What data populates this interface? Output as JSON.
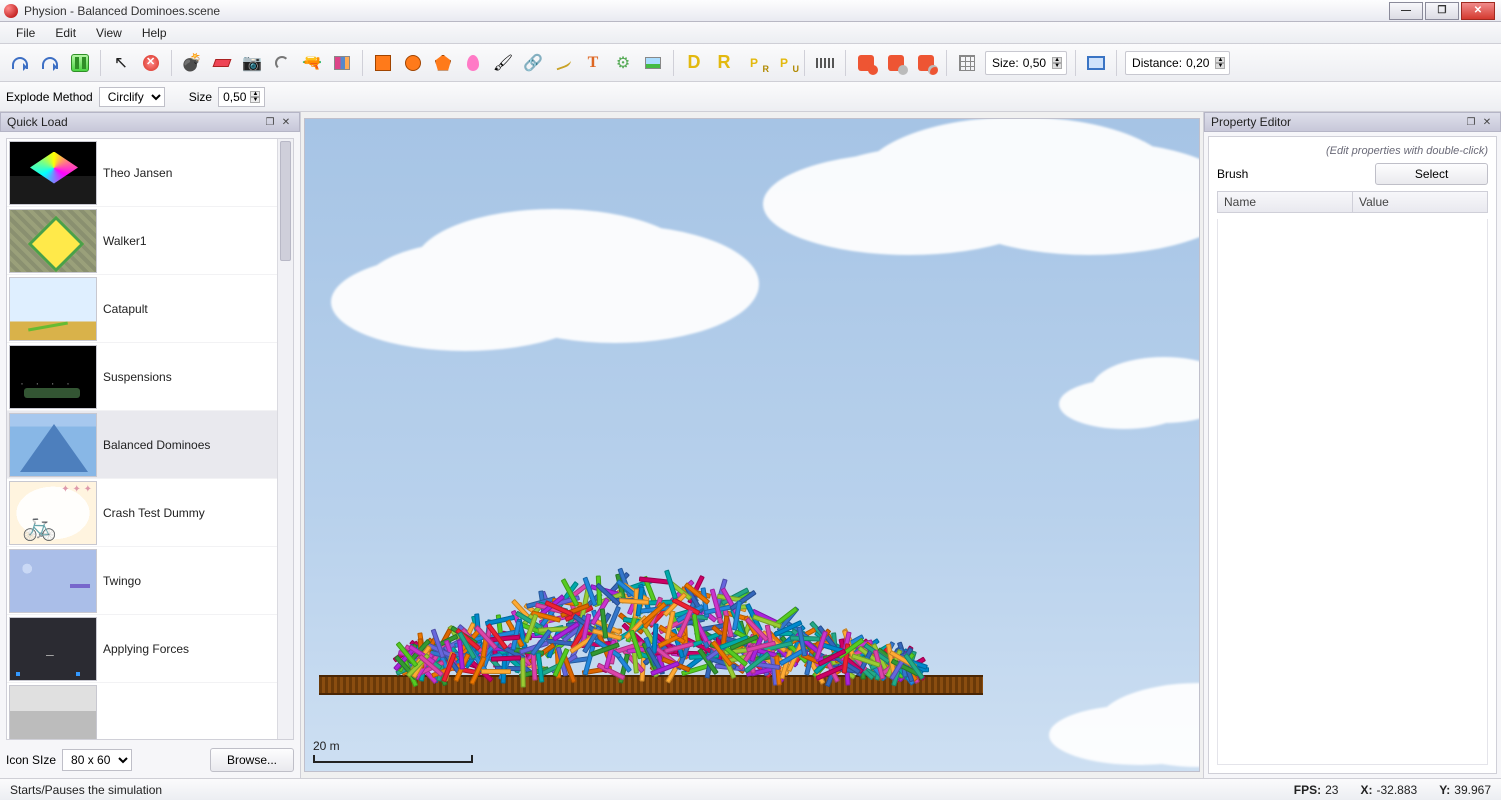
{
  "window": {
    "title": "Physion - Balanced Dominoes.scene"
  },
  "menu": {
    "file": "File",
    "edit": "Edit",
    "view": "View",
    "help": "Help"
  },
  "toolbar": {
    "size_label": "Size:",
    "size_value": "0,50",
    "distance_label": "Distance:",
    "distance_value": "0,20"
  },
  "subtoolbar": {
    "explode_label": "Explode Method",
    "explode_value": "Circlify",
    "size_label": "Size",
    "size_value": "0,50"
  },
  "quickload": {
    "title": "Quick Load",
    "items": [
      "Theo Jansen",
      "Walker1",
      "Catapult",
      "Suspensions",
      "Balanced Dominoes",
      "Crash Test Dummy",
      "Twingo",
      "Applying Forces"
    ],
    "selected_index": 4,
    "iconsize_label": "Icon SIze",
    "iconsize_value": "80 x 60",
    "browse": "Browse..."
  },
  "viewport": {
    "scale_label": "20 m"
  },
  "propeditor": {
    "title": "Property Editor",
    "hint": "(Edit properties with double-click)",
    "brush_label": "Brush",
    "select_button": "Select",
    "col_name": "Name",
    "col_value": "Value"
  },
  "status": {
    "hint": "Starts/Pauses the simulation",
    "fps_label": "FPS:",
    "fps_value": "23",
    "x_label": "X:",
    "x_value": "-32.883",
    "y_label": "Y:",
    "y_value": "39.967"
  },
  "icons": {
    "D": "D",
    "R": "R",
    "Pr": "P",
    "Pr_sub": "R",
    "Pu": "P",
    "Pu_sub": "U",
    "T": "T",
    "pointer": "↖",
    "bomb": "💣",
    "camera": "📷",
    "gun": "🔫",
    "brush": "🖌",
    "chain": "🔗",
    "gear": "⚙"
  }
}
